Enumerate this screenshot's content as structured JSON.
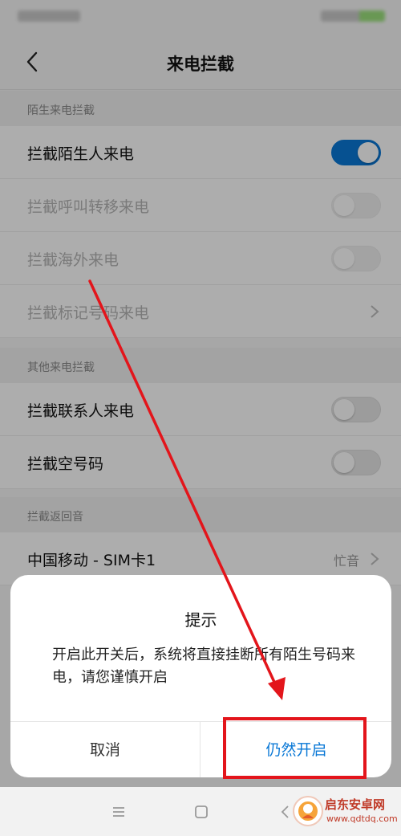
{
  "header": {
    "title": "来电拦截"
  },
  "sections": [
    {
      "header": "陌生来电拦截"
    },
    {
      "header": "其他来电拦截"
    },
    {
      "header": "拦截返回音"
    }
  ],
  "rows": {
    "block_strangers": {
      "label": "拦截陌生人来电",
      "on": true
    },
    "block_forwarded": {
      "label": "拦截呼叫转移来电",
      "on": false,
      "disabled": true
    },
    "block_overseas": {
      "label": "拦截海外来电",
      "on": false,
      "disabled": true
    },
    "block_marked": {
      "label": "拦截标记号码来电",
      "disabled": true
    },
    "block_contacts": {
      "label": "拦截联系人来电",
      "on": false
    },
    "block_empty": {
      "label": "拦截空号码",
      "on": false
    },
    "return_tone": {
      "label": "中国移动 - SIM卡1",
      "value": "忙音"
    }
  },
  "dialog": {
    "title": "提示",
    "message": "开启此开关后，系统将直接挂断所有陌生号码来电，请您谨慎开启",
    "cancel_label": "取消",
    "confirm_label": "仍然开启"
  },
  "watermark": {
    "name": "启东安卓网",
    "url": "www.qdtdq.com"
  },
  "colors": {
    "accent": "#0a78d6",
    "annotation": "#e3151b"
  },
  "icons": [
    "back-arrow-icon",
    "chevron-right-icon",
    "menu-icon",
    "home-icon",
    "back-icon"
  ]
}
